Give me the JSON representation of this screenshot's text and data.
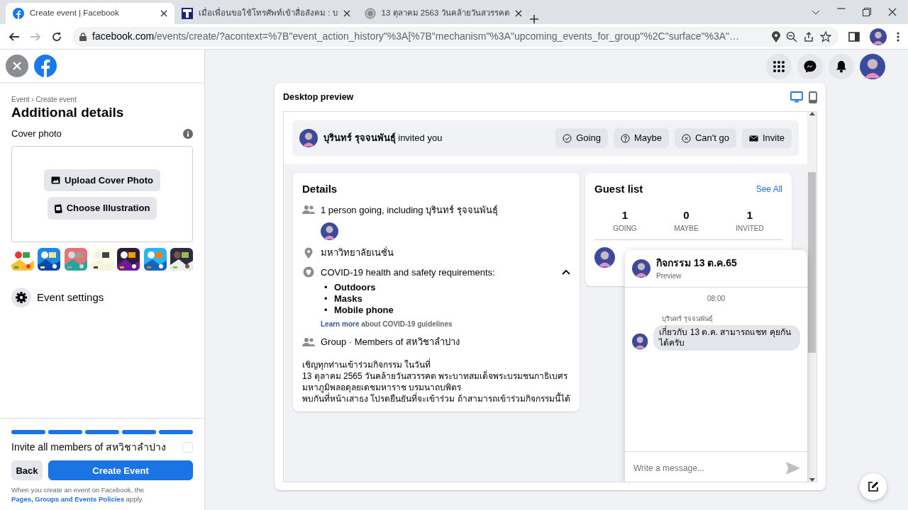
{
  "browser": {
    "tabs": [
      {
        "title": "Create event | Facebook",
        "selected": true,
        "kind": "facebook"
      },
      {
        "title": "เมื่อเพื่อนขอใช้โทรศัพท์เข้าสื่อสังคม : บ",
        "selected": false,
        "kind": "film"
      },
      {
        "title": "13 ตุลาคม 2563 วันคล้ายวันสวรรคต",
        "selected": false,
        "kind": "seal"
      }
    ],
    "url_host": "facebook.com",
    "url_path": "/events/create/?acontext=%7B\"event_action_history\"%3A[%7B\"mechanism\"%3A\"upcoming_events_for_group\"%2C\"surface\"%3A\"…"
  },
  "sidebar": {
    "breadcrumb": "Event › Create event",
    "title": "Additional details",
    "cover_label": "Cover photo",
    "upload_button": "Upload Cover Photo",
    "illustration_button": "Choose Illustration",
    "settings_label": "Event settings",
    "steps": [
      {
        "done": true
      },
      {
        "done": true
      },
      {
        "done": true
      },
      {
        "done": true
      },
      {
        "done": true
      }
    ],
    "invite_all": {
      "label": "Invite all members of สหวิชาลำปาง",
      "checked": false
    },
    "back_button": "Back",
    "create_button": "Create Event",
    "policy_text": "When you create an event on Facebook, the ",
    "policy_link": "Pages, Groups and Events Policies",
    "policy_end": " apply."
  },
  "preview": {
    "title": "Desktop preview",
    "devices": [
      {
        "kind": "desktop",
        "selected": true
      },
      {
        "kind": "mobile",
        "selected": false
      }
    ],
    "invite_bar": {
      "name": "บุรินทร์ รุจจนพันธุ์",
      "text": " invited you",
      "buttons": [
        {
          "kind": "going",
          "label": "Going"
        },
        {
          "kind": "maybe",
          "label": "Maybe"
        },
        {
          "kind": "cantgo",
          "label": "Can't go"
        },
        {
          "kind": "invite",
          "label": "Invite"
        }
      ]
    },
    "details": {
      "title": "Details",
      "going": "1 person going, including บุรินทร์ รุจจนพันธุ์",
      "location": "มหาวิทยาลัยเนชั่น",
      "covid_title": "COVID-19 health and safety requirements:",
      "covid_expanded": true,
      "covid_items": [
        {
          "bullet": "•",
          "text": "Outdoors"
        },
        {
          "bullet": "•",
          "text": "Masks"
        },
        {
          "bullet": "•",
          "text": "Mobile phone"
        }
      ],
      "covid_link": "Learn more",
      "covid_link_rest": " about COVID-19 guidelines",
      "group": "Group · Members of สหวิชาลำปาง",
      "description": [
        "เชิญทุกท่านเข้าร่วมกิจกรรม ในวันที่",
        "13 ตุลาคม 2565 วันคล้ายวันสวรรคต พระบาทสมเด็จพระบรมชนกาธิเบศร มหาภูมิพลอดุลยเดชมหาราช บรมนาถบพิตร",
        "พบกันที่หน้าเสาธง โปรดยืนยันที่จะเข้าร่วม ถ้าสามารถเข้าร่วมกิจกรรมนี้ได้"
      ]
    },
    "guest_list": {
      "title": "Guest list",
      "see_all": "See All",
      "counts": [
        {
          "value": "1",
          "label": "GOING"
        },
        {
          "value": "0",
          "label": "MAYBE"
        },
        {
          "value": "1",
          "label": "INVITED"
        }
      ]
    },
    "chat": {
      "title": "กิจกรรม 13 ต.ค.65",
      "subtitle": "Preview",
      "time": "08:00",
      "sender": "บุรินทร์ รุจจนพันธุ์",
      "message": "เกี่ยวกับ 13 ต.ค. สามารถแชท คุยกันได้ครับ",
      "placeholder": "Write a message..."
    }
  }
}
